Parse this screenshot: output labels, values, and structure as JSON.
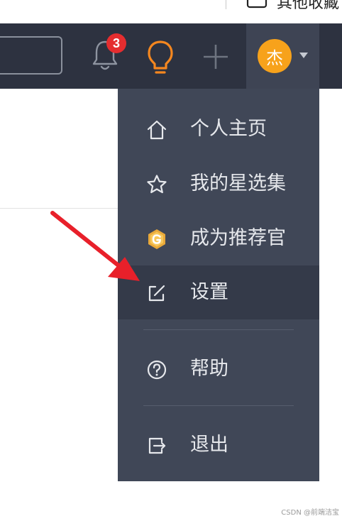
{
  "browser": {
    "bookmark_text": "其他收藏"
  },
  "navbar": {
    "notification_count": "3",
    "avatar_text": "杰"
  },
  "menu": {
    "items": [
      {
        "label": "个人主页",
        "icon": "home-icon"
      },
      {
        "label": "我的星选集",
        "icon": "star-icon"
      },
      {
        "label": "成为推荐官",
        "icon": "g-badge-icon"
      },
      {
        "label": "设置",
        "icon": "edit-icon",
        "active": true
      },
      {
        "label": "帮助",
        "icon": "question-icon"
      },
      {
        "label": "退出",
        "icon": "logout-icon"
      }
    ]
  },
  "colors": {
    "navbar_bg": "#2d3240",
    "menu_bg": "#404757",
    "menu_active_bg": "#343a49",
    "badge": "#e52d2f",
    "avatar": "#f7a21b",
    "bulb": "#f5871f",
    "arrow": "#e8202a"
  },
  "watermark": "CSDN @前端洁宝"
}
